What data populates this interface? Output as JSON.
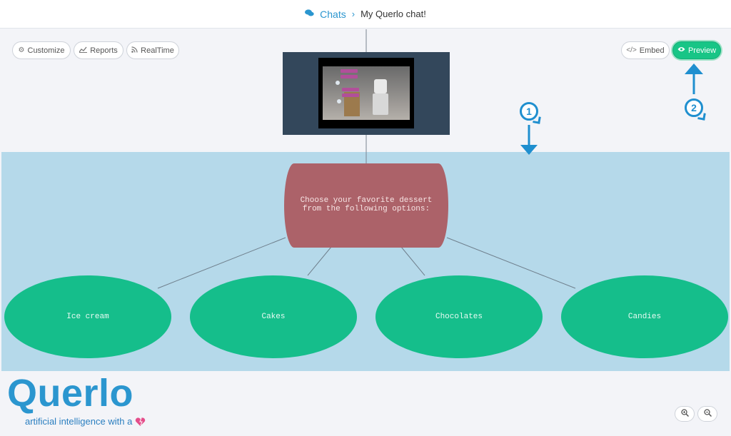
{
  "header": {
    "breadcrumb_link": "Chats",
    "separator": "›",
    "current": "My Querlo chat!"
  },
  "toolbar_left": [
    {
      "label": "Customize",
      "icon": "gear-icon"
    },
    {
      "label": "Reports",
      "icon": "line-chart-icon"
    },
    {
      "label": "RealTime",
      "icon": "rss-icon"
    }
  ],
  "toolbar_right": {
    "embed_label": "Embed",
    "preview_label": "Preview"
  },
  "video_node": {
    "content": "video thumbnail"
  },
  "question": {
    "text": "Choose your favorite dessert from the following options:"
  },
  "options": [
    {
      "label": "Ice cream"
    },
    {
      "label": "Cakes"
    },
    {
      "label": "Chocolates"
    },
    {
      "label": "Candies"
    }
  ],
  "annotations": {
    "one": "1",
    "two": "2"
  },
  "brand": {
    "logo": "Querlo",
    "tagline": "artificial intelligence with a",
    "primary_color": "#2b96cf",
    "accent_green": "#18c586",
    "question_color": "#ac6269",
    "band_color": "#b5d9ea"
  }
}
